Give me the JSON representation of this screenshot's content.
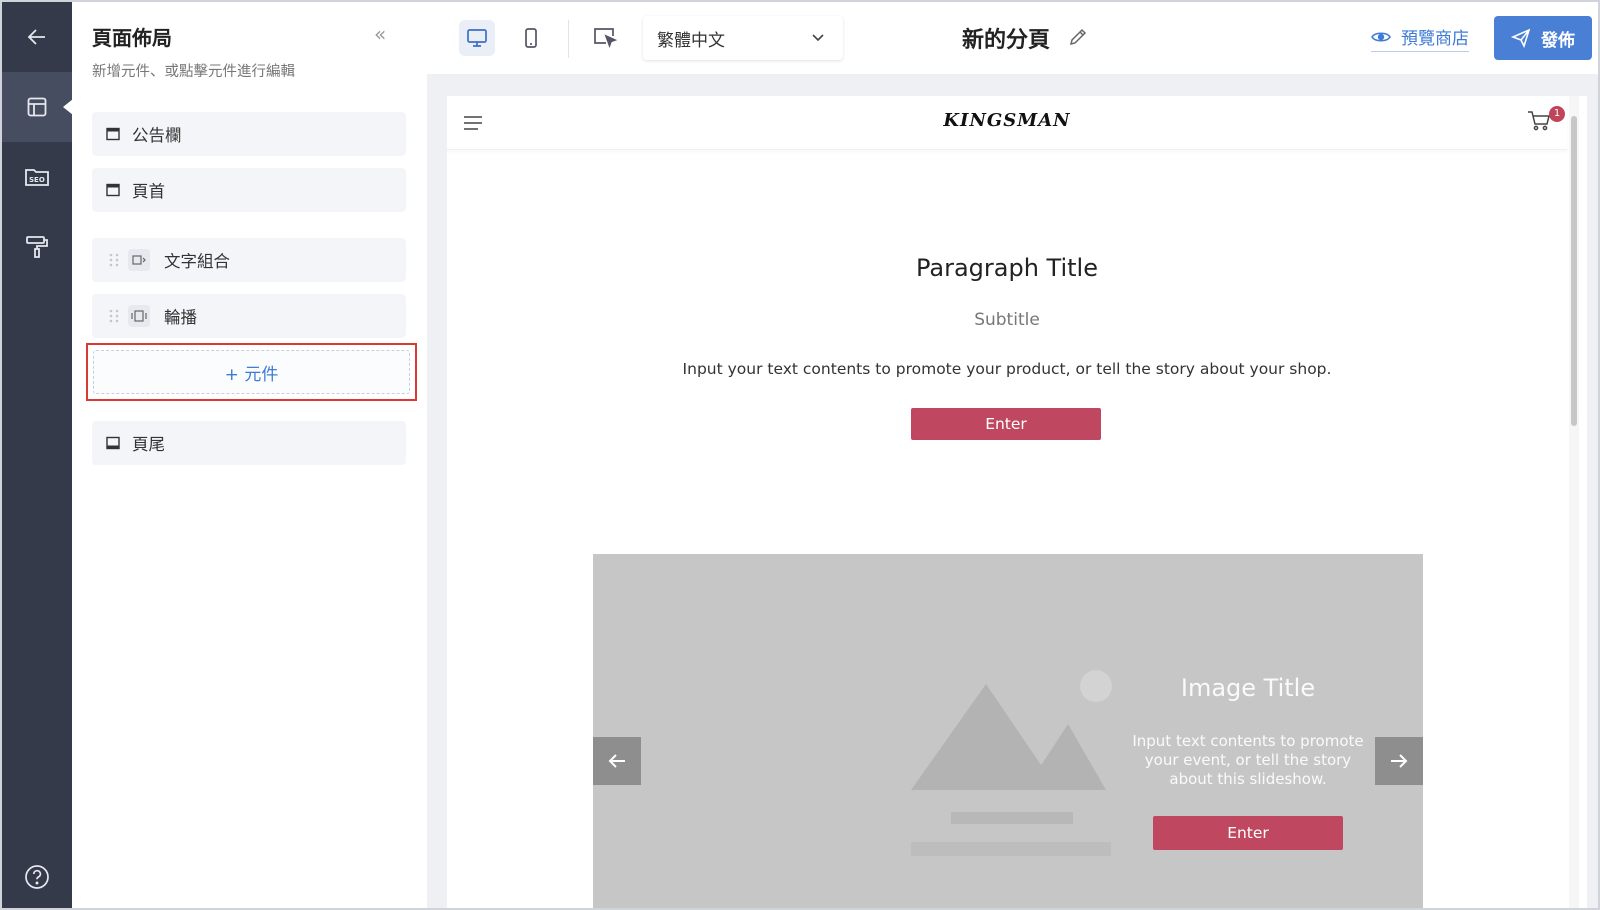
{
  "sidebar": {
    "title": "頁面佈局",
    "subtitle": "新增元件、或點擊元件進行編輯",
    "fixed_top": [
      {
        "label": "公告欄"
      },
      {
        "label": "頁首"
      }
    ],
    "modules": [
      {
        "label": "文字組合",
        "icon": "text-module-icon"
      },
      {
        "label": "輪播",
        "icon": "carousel-module-icon"
      }
    ],
    "add_label": "+ 元件",
    "footer_item": {
      "label": "頁尾"
    }
  },
  "rail": {
    "items": [
      "back-arrow-icon",
      "layout-icon",
      "seo-folder-icon",
      "paint-roller-icon"
    ],
    "seo_text": "SEO",
    "help_icon": "help-icon"
  },
  "toolbar": {
    "language": "繁體中文",
    "page_name": "新的分頁",
    "preview_label": "預覽商店",
    "publish_label": "發佈"
  },
  "preview": {
    "brand": "KINGSMAN",
    "cart_count": "1",
    "paragraph": {
      "title": "Paragraph Title",
      "subtitle": "Subtitle",
      "body": "Input your text contents to promote your product, or tell the story about your shop.",
      "button": "Enter"
    },
    "slideshow": {
      "title": "Image Title",
      "body": "Input text contents to promote your event, or tell the story about this slideshow.",
      "button": "Enter"
    }
  },
  "colors": {
    "rail_bg": "#343a4a",
    "accent_blue": "#4a7fd6",
    "link_blue": "#3d7bd6",
    "enter_red": "#bf4860",
    "highlight_red": "#d93a32"
  }
}
